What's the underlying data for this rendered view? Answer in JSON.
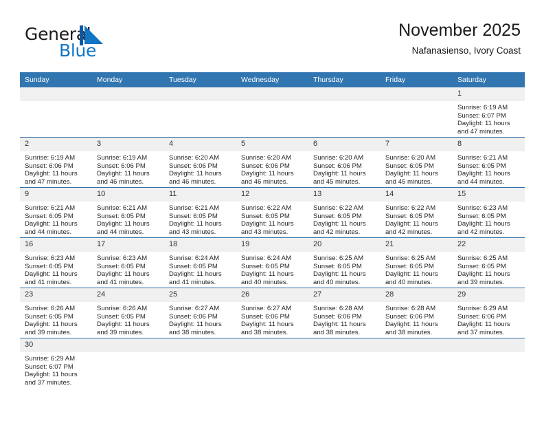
{
  "brand": {
    "name_top": "General",
    "name_bottom": "Blue",
    "mark": "triangle-logo-icon",
    "accent_color": "#1275c4"
  },
  "header": {
    "title": "November 2025",
    "subtitle": "Nafanasienso, Ivory Coast"
  },
  "theme": {
    "header_bg": "#3276b1",
    "header_text": "#ffffff",
    "row_divider": "#2f6fa8",
    "daynum_bg": "#f0f0f0"
  },
  "calendar": {
    "weekday_headers": [
      "Sunday",
      "Monday",
      "Tuesday",
      "Wednesday",
      "Thursday",
      "Friday",
      "Saturday"
    ],
    "labels": {
      "sunrise_prefix": "Sunrise: ",
      "sunset_prefix": "Sunset: ",
      "daylight_prefix": "Daylight: "
    },
    "weeks": [
      [
        {
          "empty": true
        },
        {
          "empty": true
        },
        {
          "empty": true
        },
        {
          "empty": true
        },
        {
          "empty": true
        },
        {
          "empty": true
        },
        {
          "day": "1",
          "sunrise": "Sunrise: 6:19 AM",
          "sunset": "Sunset: 6:07 PM",
          "daylight_line1": "Daylight: 11 hours",
          "daylight_line2": "and 47 minutes."
        }
      ],
      [
        {
          "day": "2",
          "sunrise": "Sunrise: 6:19 AM",
          "sunset": "Sunset: 6:06 PM",
          "daylight_line1": "Daylight: 11 hours",
          "daylight_line2": "and 47 minutes."
        },
        {
          "day": "3",
          "sunrise": "Sunrise: 6:19 AM",
          "sunset": "Sunset: 6:06 PM",
          "daylight_line1": "Daylight: 11 hours",
          "daylight_line2": "and 46 minutes."
        },
        {
          "day": "4",
          "sunrise": "Sunrise: 6:20 AM",
          "sunset": "Sunset: 6:06 PM",
          "daylight_line1": "Daylight: 11 hours",
          "daylight_line2": "and 46 minutes."
        },
        {
          "day": "5",
          "sunrise": "Sunrise: 6:20 AM",
          "sunset": "Sunset: 6:06 PM",
          "daylight_line1": "Daylight: 11 hours",
          "daylight_line2": "and 46 minutes."
        },
        {
          "day": "6",
          "sunrise": "Sunrise: 6:20 AM",
          "sunset": "Sunset: 6:06 PM",
          "daylight_line1": "Daylight: 11 hours",
          "daylight_line2": "and 45 minutes."
        },
        {
          "day": "7",
          "sunrise": "Sunrise: 6:20 AM",
          "sunset": "Sunset: 6:05 PM",
          "daylight_line1": "Daylight: 11 hours",
          "daylight_line2": "and 45 minutes."
        },
        {
          "day": "8",
          "sunrise": "Sunrise: 6:21 AM",
          "sunset": "Sunset: 6:05 PM",
          "daylight_line1": "Daylight: 11 hours",
          "daylight_line2": "and 44 minutes."
        }
      ],
      [
        {
          "day": "9",
          "sunrise": "Sunrise: 6:21 AM",
          "sunset": "Sunset: 6:05 PM",
          "daylight_line1": "Daylight: 11 hours",
          "daylight_line2": "and 44 minutes."
        },
        {
          "day": "10",
          "sunrise": "Sunrise: 6:21 AM",
          "sunset": "Sunset: 6:05 PM",
          "daylight_line1": "Daylight: 11 hours",
          "daylight_line2": "and 44 minutes."
        },
        {
          "day": "11",
          "sunrise": "Sunrise: 6:21 AM",
          "sunset": "Sunset: 6:05 PM",
          "daylight_line1": "Daylight: 11 hours",
          "daylight_line2": "and 43 minutes."
        },
        {
          "day": "12",
          "sunrise": "Sunrise: 6:22 AM",
          "sunset": "Sunset: 6:05 PM",
          "daylight_line1": "Daylight: 11 hours",
          "daylight_line2": "and 43 minutes."
        },
        {
          "day": "13",
          "sunrise": "Sunrise: 6:22 AM",
          "sunset": "Sunset: 6:05 PM",
          "daylight_line1": "Daylight: 11 hours",
          "daylight_line2": "and 42 minutes."
        },
        {
          "day": "14",
          "sunrise": "Sunrise: 6:22 AM",
          "sunset": "Sunset: 6:05 PM",
          "daylight_line1": "Daylight: 11 hours",
          "daylight_line2": "and 42 minutes."
        },
        {
          "day": "15",
          "sunrise": "Sunrise: 6:23 AM",
          "sunset": "Sunset: 6:05 PM",
          "daylight_line1": "Daylight: 11 hours",
          "daylight_line2": "and 42 minutes."
        }
      ],
      [
        {
          "day": "16",
          "sunrise": "Sunrise: 6:23 AM",
          "sunset": "Sunset: 6:05 PM",
          "daylight_line1": "Daylight: 11 hours",
          "daylight_line2": "and 41 minutes."
        },
        {
          "day": "17",
          "sunrise": "Sunrise: 6:23 AM",
          "sunset": "Sunset: 6:05 PM",
          "daylight_line1": "Daylight: 11 hours",
          "daylight_line2": "and 41 minutes."
        },
        {
          "day": "18",
          "sunrise": "Sunrise: 6:24 AM",
          "sunset": "Sunset: 6:05 PM",
          "daylight_line1": "Daylight: 11 hours",
          "daylight_line2": "and 41 minutes."
        },
        {
          "day": "19",
          "sunrise": "Sunrise: 6:24 AM",
          "sunset": "Sunset: 6:05 PM",
          "daylight_line1": "Daylight: 11 hours",
          "daylight_line2": "and 40 minutes."
        },
        {
          "day": "20",
          "sunrise": "Sunrise: 6:25 AM",
          "sunset": "Sunset: 6:05 PM",
          "daylight_line1": "Daylight: 11 hours",
          "daylight_line2": "and 40 minutes."
        },
        {
          "day": "21",
          "sunrise": "Sunrise: 6:25 AM",
          "sunset": "Sunset: 6:05 PM",
          "daylight_line1": "Daylight: 11 hours",
          "daylight_line2": "and 40 minutes."
        },
        {
          "day": "22",
          "sunrise": "Sunrise: 6:25 AM",
          "sunset": "Sunset: 6:05 PM",
          "daylight_line1": "Daylight: 11 hours",
          "daylight_line2": "and 39 minutes."
        }
      ],
      [
        {
          "day": "23",
          "sunrise": "Sunrise: 6:26 AM",
          "sunset": "Sunset: 6:05 PM",
          "daylight_line1": "Daylight: 11 hours",
          "daylight_line2": "and 39 minutes."
        },
        {
          "day": "24",
          "sunrise": "Sunrise: 6:26 AM",
          "sunset": "Sunset: 6:05 PM",
          "daylight_line1": "Daylight: 11 hours",
          "daylight_line2": "and 39 minutes."
        },
        {
          "day": "25",
          "sunrise": "Sunrise: 6:27 AM",
          "sunset": "Sunset: 6:06 PM",
          "daylight_line1": "Daylight: 11 hours",
          "daylight_line2": "and 38 minutes."
        },
        {
          "day": "26",
          "sunrise": "Sunrise: 6:27 AM",
          "sunset": "Sunset: 6:06 PM",
          "daylight_line1": "Daylight: 11 hours",
          "daylight_line2": "and 38 minutes."
        },
        {
          "day": "27",
          "sunrise": "Sunrise: 6:28 AM",
          "sunset": "Sunset: 6:06 PM",
          "daylight_line1": "Daylight: 11 hours",
          "daylight_line2": "and 38 minutes."
        },
        {
          "day": "28",
          "sunrise": "Sunrise: 6:28 AM",
          "sunset": "Sunset: 6:06 PM",
          "daylight_line1": "Daylight: 11 hours",
          "daylight_line2": "and 38 minutes."
        },
        {
          "day": "29",
          "sunrise": "Sunrise: 6:29 AM",
          "sunset": "Sunset: 6:06 PM",
          "daylight_line1": "Daylight: 11 hours",
          "daylight_line2": "and 37 minutes."
        }
      ],
      [
        {
          "day": "30",
          "sunrise": "Sunrise: 6:29 AM",
          "sunset": "Sunset: 6:07 PM",
          "daylight_line1": "Daylight: 11 hours",
          "daylight_line2": "and 37 minutes."
        },
        {
          "empty": true
        },
        {
          "empty": true
        },
        {
          "empty": true
        },
        {
          "empty": true
        },
        {
          "empty": true
        },
        {
          "empty": true
        }
      ]
    ]
  }
}
